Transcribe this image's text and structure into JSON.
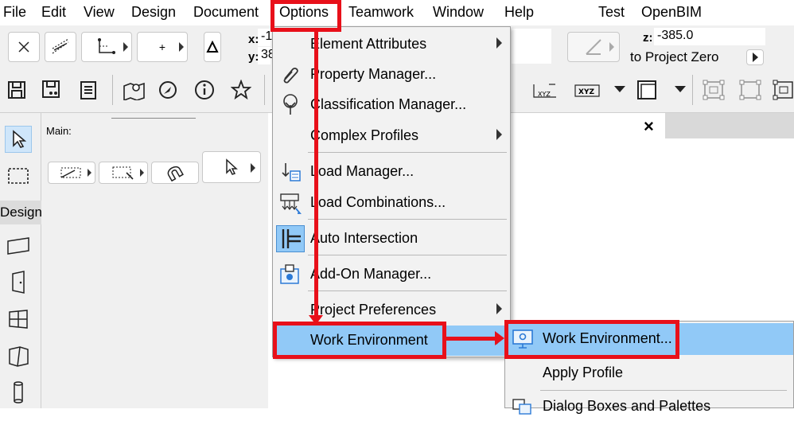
{
  "menubar": {
    "items": [
      "File",
      "Edit",
      "View",
      "Design",
      "Document",
      "Options",
      "Teamwork",
      "Window",
      "Help",
      "Test",
      "OpenBIM"
    ]
  },
  "coords": {
    "x_label": "x:",
    "x_value": "-1",
    "y_label": "y:",
    "y_value": "38",
    "z_label": "z:",
    "z_value": "-385.0",
    "reference": "to Project Zero"
  },
  "infobox": {
    "main_label": "Main:"
  },
  "toolbox": {
    "design_label": "Design"
  },
  "tabbar": {
    "close_glyph": "×"
  },
  "options_menu": {
    "items": [
      {
        "label": "Element Attributes",
        "submenu": true,
        "icon": "none"
      },
      {
        "label": "Property Manager...",
        "submenu": false,
        "icon": "paperclip-icon"
      },
      {
        "label": "Classification Manager...",
        "submenu": false,
        "icon": "tree-icon"
      },
      {
        "label": "Complex Profiles",
        "submenu": true,
        "icon": "none"
      },
      {
        "label": "Load Manager...",
        "submenu": false,
        "icon": "load-manager-icon"
      },
      {
        "label": "Load Combinations...",
        "submenu": false,
        "icon": "load-combinations-icon"
      },
      {
        "label": "Auto Intersection",
        "submenu": false,
        "icon": "auto-intersection-icon"
      },
      {
        "label": "Add-On Manager...",
        "submenu": false,
        "icon": "addon-icon"
      },
      {
        "label": "Project Preferences",
        "submenu": true,
        "icon": "none"
      },
      {
        "label": "Work Environment",
        "submenu": true,
        "icon": "none",
        "highlighted": true
      }
    ]
  },
  "submenu": {
    "items": [
      {
        "label": "Work Environment...",
        "highlighted": true,
        "icon": "work-environment-icon"
      },
      {
        "label": "Apply Profile"
      },
      {
        "label": "Dialog Boxes and Palettes"
      }
    ]
  },
  "colors": {
    "annotation_red": "#e8101a",
    "highlight_blue": "#91c9f7",
    "menu_bg": "#f2f2f2"
  }
}
